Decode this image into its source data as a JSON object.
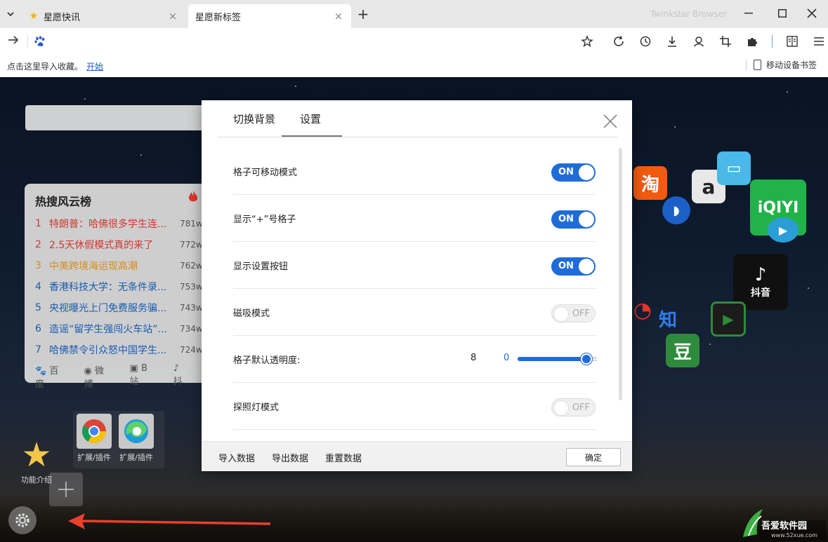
{
  "browser": {
    "tabs": [
      {
        "title": "星愿快讯",
        "active": false
      },
      {
        "title": "星愿新标签",
        "active": true
      }
    ],
    "new_tab": "+",
    "brand": "Twinkstar Browser"
  },
  "bookmark_bar": {
    "hint": "点击这里导入收藏。",
    "start_link": "开始",
    "mobile_bookmarks": "移动设备书签"
  },
  "hot_panel": {
    "title": "热搜风云榜",
    "items": [
      {
        "rank": "1",
        "text": "特朗普：哈佛很多学生连...",
        "count": "781w",
        "color": "#d63a2f"
      },
      {
        "rank": "2",
        "text": "2.5天休假模式真的来了",
        "count": "772w",
        "color": "#d63a2f"
      },
      {
        "rank": "3",
        "text": "中美跨境海运现高潮",
        "count": "762w",
        "color": "#e0901c"
      },
      {
        "rank": "4",
        "text": "香港科技大学：无条件录...",
        "count": "753w",
        "color": "#1a5fb4"
      },
      {
        "rank": "5",
        "text": "央视曝光上门免费服务骗...",
        "count": "743w",
        "color": "#1a5fb4"
      },
      {
        "rank": "6",
        "text": "造谣“留学生强闯火车站”...",
        "count": "734w",
        "color": "#1a5fb4"
      },
      {
        "rank": "7",
        "text": "哈佛禁令引众怒中国学生...",
        "count": "724w",
        "color": "#1a5fb4"
      }
    ],
    "sources": [
      "百度",
      "微博",
      "B站",
      "抖"
    ]
  },
  "tiles": {
    "extensions": [
      "扩展/插件",
      "扩展/插件"
    ],
    "intro": "功能介绍",
    "apps": [
      "淘",
      "a",
      "iQIYI",
      "抖音",
      "知",
      "豆"
    ]
  },
  "watermark": {
    "text": "吾爱软件园",
    "sub": "www.52xue.com"
  },
  "dialog": {
    "tabs": [
      "切换背景",
      "设置"
    ],
    "settings": [
      {
        "label": "格子可移动模式",
        "state": "ON",
        "on": true
      },
      {
        "label": "显示“+”号格子",
        "state": "ON",
        "on": true
      },
      {
        "label": "显示设置按钮",
        "state": "ON",
        "on": true
      },
      {
        "label": "磁吸模式",
        "state": "OFF",
        "on": false
      }
    ],
    "opacity": {
      "label": "格子默认透明度:",
      "current": "8",
      "min": "0",
      "max": "10",
      "value": 8
    },
    "spotlight": {
      "label": "探照灯模式",
      "state": "OFF",
      "on": false
    },
    "footer": {
      "import": "导入数据",
      "export": "导出数据",
      "reset": "重置数据",
      "ok": "确定"
    }
  },
  "colors": {
    "accent": "#1f6cd8",
    "toggle_off": "#f0f0f0"
  }
}
